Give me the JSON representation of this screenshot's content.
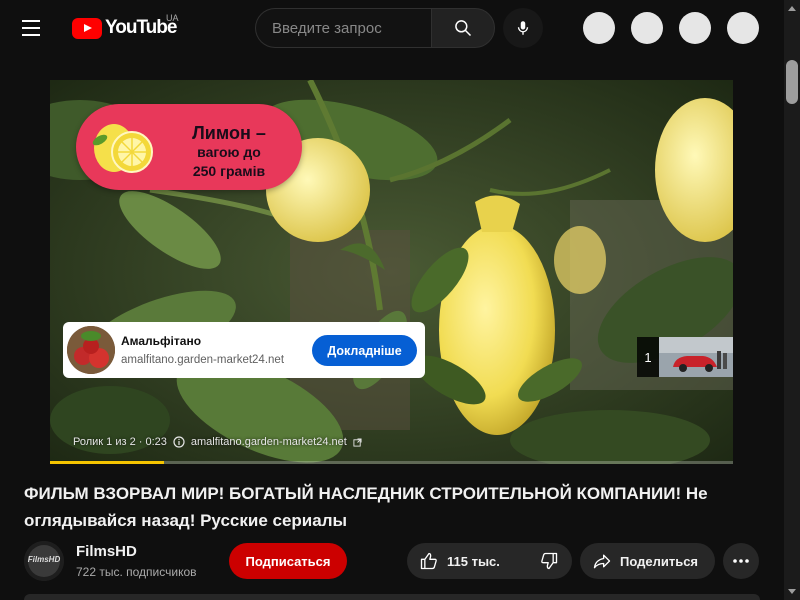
{
  "header": {
    "logo_text": "YouTube",
    "country_code": "UA",
    "search_placeholder": "Введите запрос"
  },
  "player": {
    "promo": {
      "line1": "Лимон –",
      "line2": "вагою до",
      "line3": "250 грамів"
    },
    "ad_card": {
      "title": "Амальфітано",
      "url": "amalfitano.garden-market24.net",
      "cta": "Докладніше"
    },
    "ad_info": {
      "position": "Ролик 1 из 2 · 0:23",
      "domain": "amalfitano.garden-market24.net"
    },
    "queue_count": "1",
    "progress_fraction": 0.167
  },
  "video": {
    "title": "ФИЛЬМ ВЗОРВАЛ МИР! БОГАТЫЙ НАСЛЕДНИК СТРОИТЕЛЬНОЙ КОМПАНИИ! Не оглядывайся назад! Русские сериалы"
  },
  "channel": {
    "name": "FilmsHD",
    "avatar_text": "FilmsHD",
    "subscribers": "722 тыс. подписчиков",
    "subscribe_label": "Подписаться"
  },
  "actions": {
    "likes": "115 тыс.",
    "share_label": "Поделиться"
  },
  "colors": {
    "background": "#0f0f0f",
    "brand_red": "#ff0000",
    "subscribe_red": "#cc0000",
    "ad_cta_blue": "#065fd4",
    "promo_pink": "#e8385a",
    "progress_yellow": "#f5c400"
  }
}
